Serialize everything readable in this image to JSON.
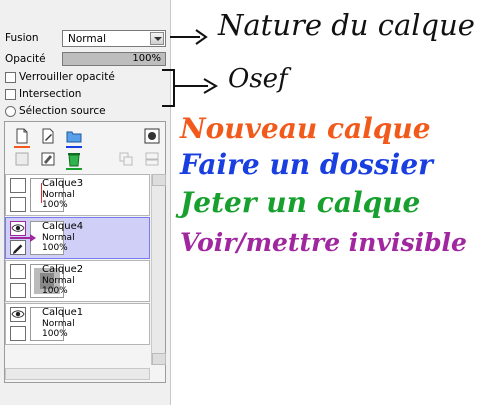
{
  "panel": {
    "fusion_label": "Fusion",
    "fusion_value": "Normal",
    "opacity_label": "Opacité",
    "opacity_value": "100%",
    "opacity_fraction": 1.0,
    "checkboxes": [
      {
        "label": "Verrouiller opacité",
        "checked": false
      },
      {
        "label": "Intersection",
        "checked": false
      }
    ],
    "radio_label": "Sélection source"
  },
  "toolbar": {
    "icons": [
      "new-layer-icon",
      "new-raster-icon",
      "new-folder-icon",
      "mask-icon",
      "clear-icon",
      "delete-layer-icon",
      "merge-icon",
      "merge-down-icon"
    ]
  },
  "layers": [
    {
      "name": "Calque3",
      "mode": "Normal",
      "opacity": "100%",
      "visible": false,
      "selected": false
    },
    {
      "name": "Calque4",
      "mode": "Normal",
      "opacity": "100%",
      "visible": true,
      "selected": true
    },
    {
      "name": "Calque2",
      "mode": "Normal",
      "opacity": "100%",
      "visible": false,
      "selected": false
    },
    {
      "name": "Calque1",
      "mode": "Normal",
      "opacity": "100%",
      "visible": true,
      "selected": false
    }
  ],
  "annotations": {
    "nature": "Nature du calque",
    "osef": "Osef",
    "nouveau": "Nouveau calque",
    "dossier": "Faire un dossier",
    "jeter": "Jeter un calque",
    "voir": "Voir/mettre invisible",
    "colors": {
      "nouveau": "#f25a1c",
      "dossier": "#1a3fe0",
      "jeter": "#17a02e",
      "voir": "#a0279f"
    }
  }
}
